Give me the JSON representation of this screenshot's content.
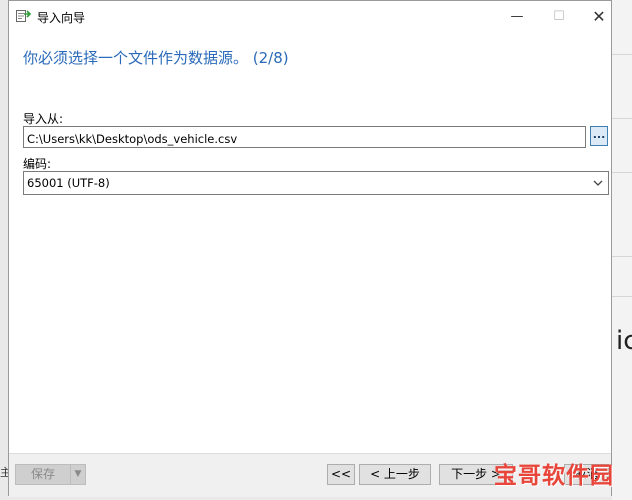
{
  "window": {
    "title": "导入向导",
    "minimize_symbol": "—",
    "maximize_symbol": "☐",
    "close_symbol": "✕"
  },
  "heading": "你必须选择一个文件作为数据源。 (2/8)",
  "import_from": {
    "label": "导入从:",
    "value": "C:\\Users\\kk\\Desktop\\ods_vehicle.csv",
    "browse_label": "..."
  },
  "encoding": {
    "label": "编码:",
    "value": "65001 (UTF-8)"
  },
  "footer": {
    "save_label": "保存",
    "first_label": "<<",
    "prev_label": "< 上一步",
    "next_label": "下一步 >",
    "cancel_label": "取消"
  },
  "background": {
    "left_text": "主",
    "right_glyph": "ic"
  },
  "watermark": {
    "text": "宝哥软件园"
  },
  "colors": {
    "heading": "#2a6ab8",
    "accent": "#3c7fb1",
    "watermark": "#e8463b"
  },
  "icons": {
    "app": "import-wizard-icon",
    "dropdown": "chevron-down-icon"
  }
}
